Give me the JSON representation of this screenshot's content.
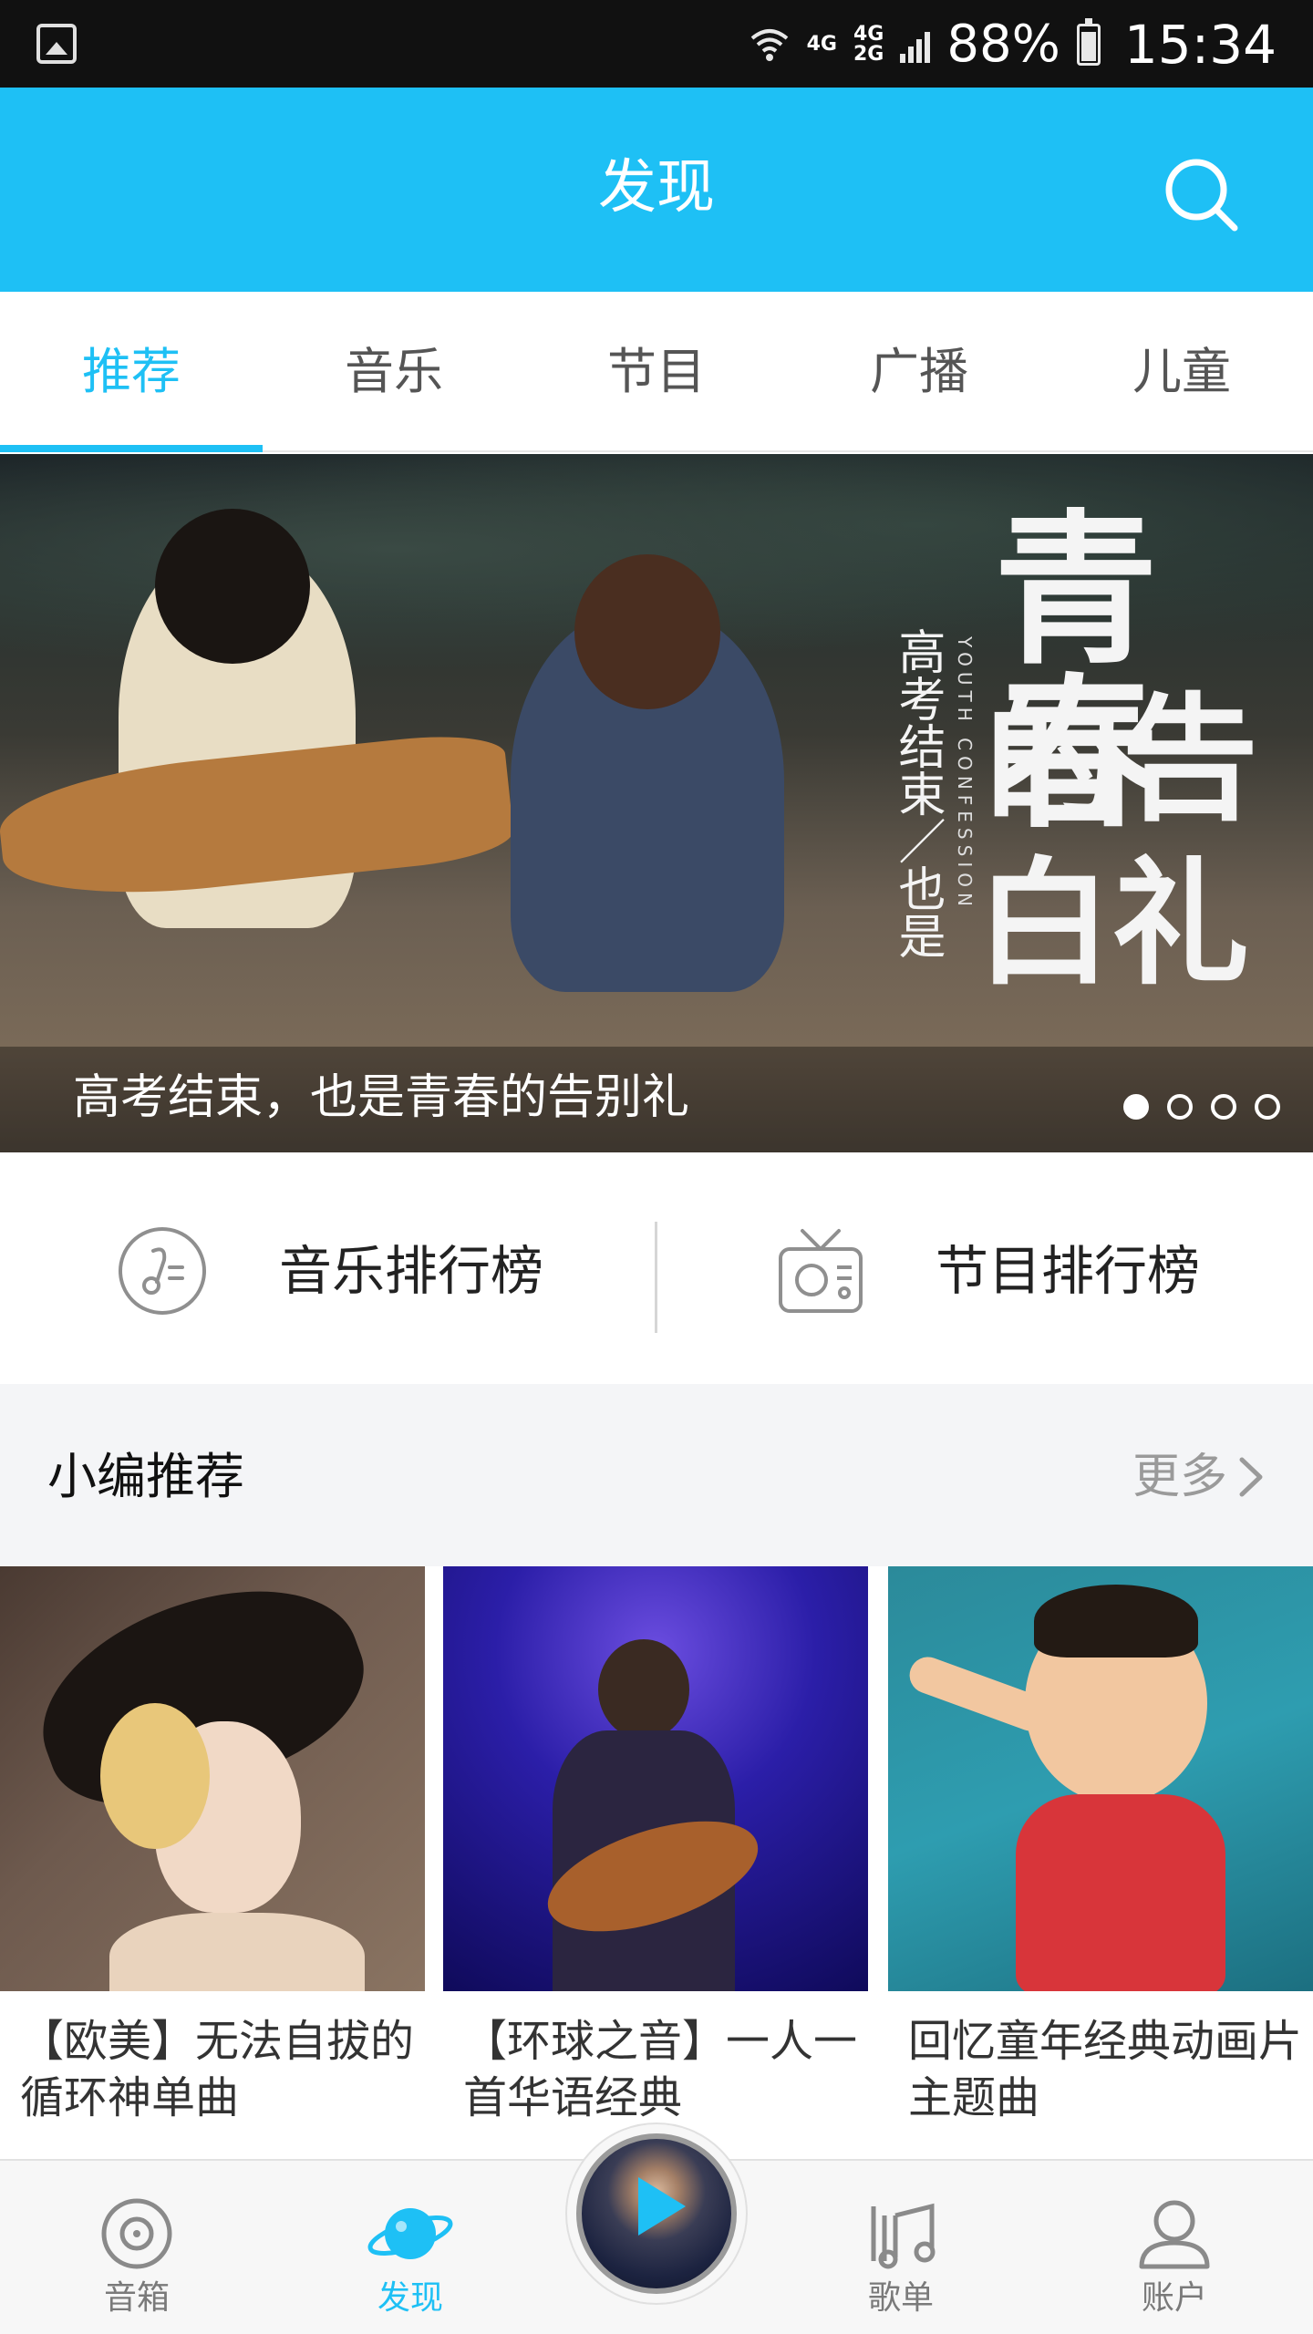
{
  "status_bar": {
    "network_1": "4G",
    "network_2": "4G",
    "network_3": "2G",
    "battery": "88%",
    "time": "15:34"
  },
  "header": {
    "title": "发现",
    "search_icon": "search-icon"
  },
  "tabs": [
    {
      "label": "推荐",
      "active": true
    },
    {
      "label": "音乐",
      "active": false
    },
    {
      "label": "节目",
      "active": false
    },
    {
      "label": "广播",
      "active": false
    },
    {
      "label": "儿童",
      "active": false
    }
  ],
  "banner": {
    "caption": "高考结束，也是青春的告别礼",
    "poster_vertical_text": "高考结束／也是",
    "poster_english_text": "YOUTH CONFESSION",
    "poster_big_1": "青春",
    "poster_big_2": "的告",
    "poster_big_3": "白礼",
    "slide_count": 4,
    "active_slide": 1
  },
  "rankings": [
    {
      "label": "音乐排行榜",
      "icon": "music-note-icon"
    },
    {
      "label": "节目排行榜",
      "icon": "radio-icon"
    }
  ],
  "section": {
    "title": "小编推荐",
    "more": "更多",
    "more_icon": "chevron-right-icon"
  },
  "cards": [
    {
      "title": "【欧美】无法自拔的循环神单曲"
    },
    {
      "title": "【环球之音】一人一首华语经典"
    },
    {
      "title": "回忆童年经典动画片主题曲"
    }
  ],
  "bottom_nav": [
    {
      "label": "音箱",
      "icon": "speaker-icon",
      "active": false
    },
    {
      "label": "发现",
      "icon": "planet-icon",
      "active": true
    },
    {
      "label": "歌单",
      "icon": "playlist-icon",
      "active": false
    },
    {
      "label": "账户",
      "icon": "account-icon",
      "active": false
    }
  ],
  "colors": {
    "accent": "#1ec0f5",
    "status_bar": "#111111",
    "section_bg": "#f4f5f7",
    "nav_inactive": "#7a7a7a"
  }
}
